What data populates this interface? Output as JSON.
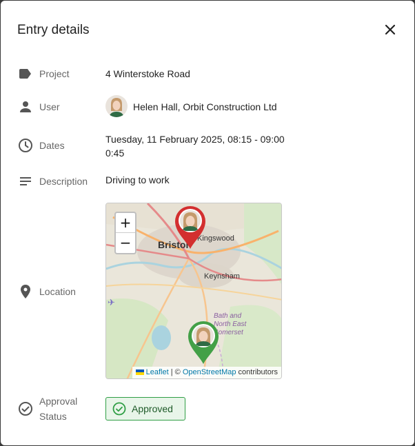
{
  "dialog": {
    "title": "Entry details",
    "close_icon": "close-icon"
  },
  "fields": {
    "project": {
      "label": "Project",
      "value": "4 Winterstoke Road",
      "icon": "tag-icon"
    },
    "user": {
      "label": "User",
      "value": "Helen Hall, Orbit Construction Ltd",
      "icon": "person-icon"
    },
    "dates": {
      "label": "Dates",
      "line1": "Tuesday, 11 February 2025, 08:15 - 09:00",
      "line2": "0:45",
      "icon": "clock-icon"
    },
    "description": {
      "label": "Description",
      "value": "Driving to work",
      "icon": "notes-icon"
    },
    "location": {
      "label": "Location",
      "icon": "location-pin-icon"
    },
    "approval": {
      "label_line1": "Approval",
      "label_line2": "Status",
      "value": "Approved",
      "icon": "check-circle-icon"
    }
  },
  "map": {
    "zoom_in": "+",
    "zoom_out": "−",
    "places": {
      "bristol": "Bristol",
      "kingswood": "Kingswood",
      "keynsham": "Keynsham",
      "bath_line1": "Bath and",
      "bath_line2": "North East",
      "bath_line3": "Somerset"
    },
    "attribution": {
      "leaflet": "Leaflet",
      "separator": " | © ",
      "osm": "OpenStreetMap",
      "contributors": " contributors"
    },
    "marker_start_color": "#d32f2f",
    "marker_end_color": "#43a047"
  },
  "colors": {
    "approved_border": "#2e9e44",
    "approved_bg": "#e8f5e9",
    "icon_gray": "#555555"
  }
}
